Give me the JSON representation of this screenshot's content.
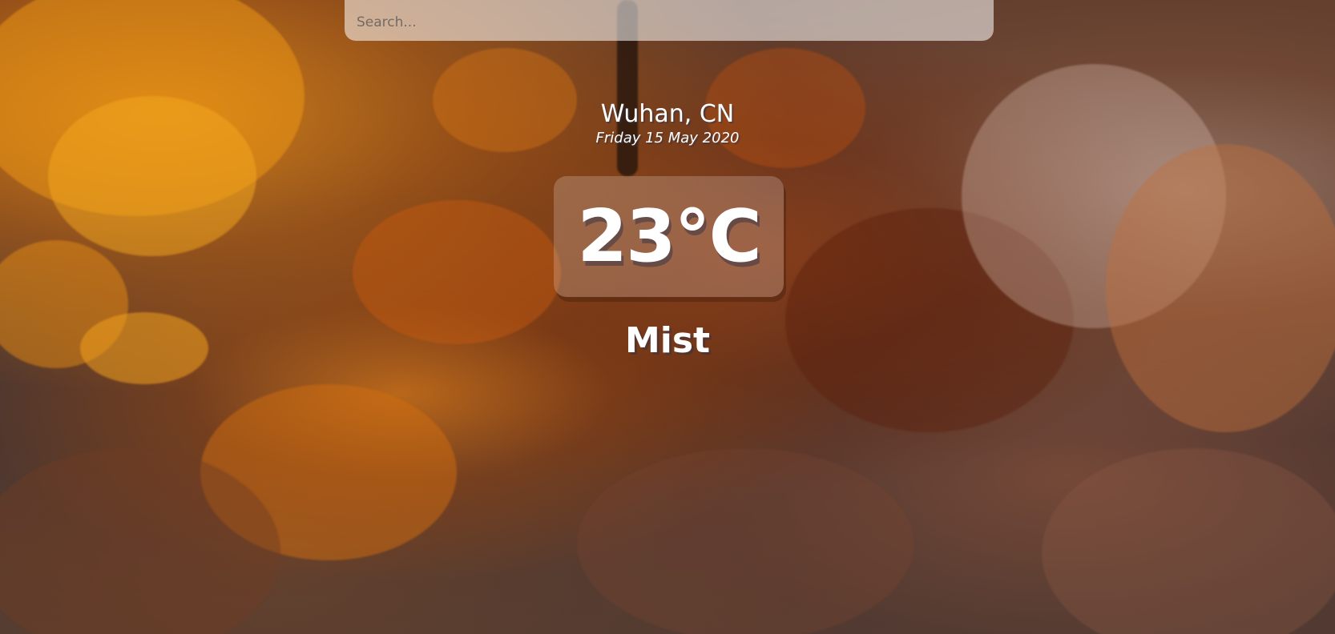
{
  "search": {
    "placeholder": "Search...",
    "value": ""
  },
  "location": {
    "city": "Wuhan, CN",
    "date": "Friday 15 May 2020"
  },
  "weather": {
    "temperature": "23°C",
    "condition": "Mist"
  },
  "colors": {
    "text": "#ffffff",
    "panel": "rgba(255,255,255,0.2)",
    "search_bg": "rgba(255,255,255,0.55)"
  }
}
